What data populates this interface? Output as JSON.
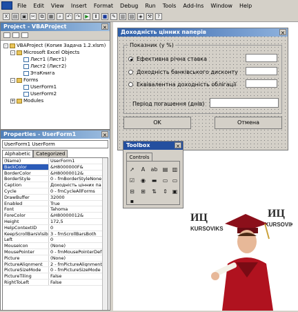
{
  "menu": [
    "File",
    "Edit",
    "View",
    "Insert",
    "Format",
    "Debug",
    "Run",
    "Tools",
    "Add-Ins",
    "Window",
    "Help"
  ],
  "project": {
    "title": "Project - VBAProject",
    "nodes": [
      {
        "label": "VBAProject (Копия Задача 1.2.xlsm)",
        "level": 0,
        "exp": "-"
      },
      {
        "label": "Microsoft Excel Objects",
        "level": 1,
        "exp": "-"
      },
      {
        "label": "Лист1 (Лист1)",
        "level": 2,
        "exp": ""
      },
      {
        "label": "Лист2 (Лист2)",
        "level": 2,
        "exp": ""
      },
      {
        "label": "ЭтаКнига",
        "level": 2,
        "exp": ""
      },
      {
        "label": "Forms",
        "level": 1,
        "exp": "-"
      },
      {
        "label": "UserForm1",
        "level": 2,
        "exp": ""
      },
      {
        "label": "UserForm2",
        "level": 2,
        "exp": ""
      },
      {
        "label": "Modules",
        "level": 1,
        "exp": "+"
      }
    ]
  },
  "properties": {
    "title": "Properties - UserForm1",
    "object": "UserForm1 UserForm",
    "tabs": [
      "Alphabetic",
      "Categorized"
    ],
    "rows": [
      [
        "(Name)",
        "UserForm1"
      ],
      [
        "BackColor",
        "&H8000000F&"
      ],
      [
        "BorderColor",
        "&H80000012&"
      ],
      [
        "BorderStyle",
        "0 - fmBorderStyleNone"
      ],
      [
        "Caption",
        "Доходність цінних па"
      ],
      [
        "Cycle",
        "0 - fmCycleAllForms"
      ],
      [
        "DrawBuffer",
        "32000"
      ],
      [
        "Enabled",
        "True"
      ],
      [
        "Font",
        "Tahoma"
      ],
      [
        "ForeColor",
        "&H80000012&"
      ],
      [
        "Height",
        "172,5"
      ],
      [
        "HelpContextID",
        "0"
      ],
      [
        "KeepScrollBarsVisible",
        "3 - fmScrollBarsBoth"
      ],
      [
        "Left",
        "0"
      ],
      [
        "MouseIcon",
        "(None)"
      ],
      [
        "MousePointer",
        "0 - fmMousePointerDef"
      ],
      [
        "Picture",
        "(None)"
      ],
      [
        "PictureAlignment",
        "2 - fmPictureAlignment"
      ],
      [
        "PictureSizeMode",
        "0 - fmPictureSizeMode"
      ],
      [
        "PictureTiling",
        "False"
      ],
      [
        "RightToLeft",
        "False"
      ]
    ]
  },
  "form": {
    "title": "Доходність цінних паперів",
    "frame_caption": "Показник (у %)",
    "options": [
      {
        "label": "Ефективна річна ставка",
        "selected": true
      },
      {
        "label": "Доходність банківського дисконту",
        "selected": false
      },
      {
        "label": "Еквівалентна доходність облігації",
        "selected": false
      }
    ],
    "period_label": "Період погашення (днів)",
    "ok_label": "OK",
    "cancel_label": "Отмена"
  },
  "toolbox": {
    "title": "Toolbox",
    "tab": "Controls"
  },
  "logo": {
    "left": "ИЦ",
    "right": "ИЦ",
    "brand_left": "KURSOVIKS",
    "brand_right": "KURSOVIKS"
  }
}
